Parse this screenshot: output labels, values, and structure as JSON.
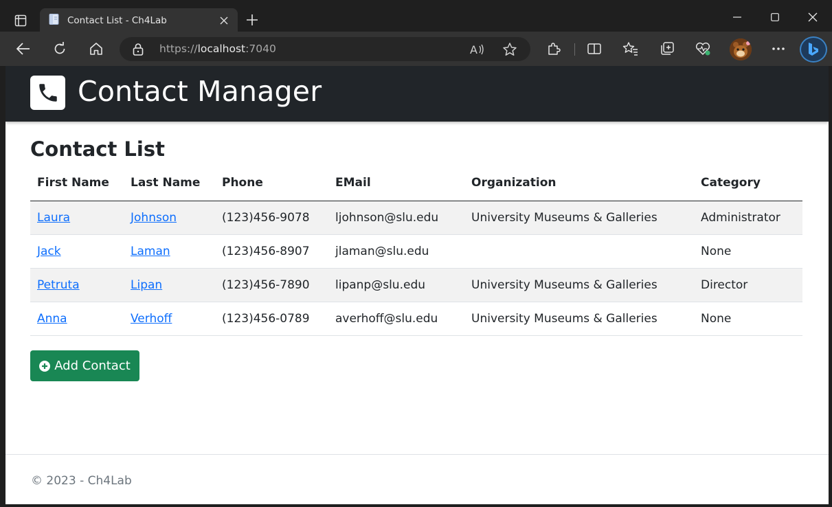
{
  "browser": {
    "tab_title": "Contact List - Ch4Lab",
    "address": {
      "scheme": "https://",
      "host": "localhost",
      "port": ":7040"
    },
    "icons": [
      "tab-actions-icon",
      "page-icon",
      "close-icon",
      "plus-icon",
      "minimize-icon",
      "maximize-icon",
      "window-close-icon",
      "back-icon",
      "refresh-icon",
      "home-icon",
      "lock-icon",
      "read-aloud-icon",
      "favorite-star-icon",
      "extensions-icon",
      "split-screen-icon",
      "favorites-icon",
      "collections-icon",
      "browser-essentials-icon",
      "profile-avatar-icon",
      "more-icon",
      "bing-copilot-icon"
    ]
  },
  "site": {
    "brand": "Contact Manager",
    "logo_icon": "phone-icon"
  },
  "main": {
    "title": "Contact List",
    "columns": [
      "First Name",
      "Last Name",
      "Phone",
      "EMail",
      "Organization",
      "Category"
    ],
    "rows": [
      {
        "first": "Laura",
        "last": "Johnson",
        "phone": "(123)456-9078",
        "email": "ljohnson@slu.edu",
        "organization": "University Museums & Galleries",
        "category": "Administrator"
      },
      {
        "first": "Jack",
        "last": "Laman",
        "phone": "(123)456-8907",
        "email": "jlaman@slu.edu",
        "organization": "",
        "category": "None"
      },
      {
        "first": "Petruta",
        "last": "Lipan",
        "phone": "(123)456-7890",
        "email": "lipanp@slu.edu",
        "organization": "University Museums & Galleries",
        "category": "Director"
      },
      {
        "first": "Anna",
        "last": "Verhoff",
        "phone": "(123)456-0789",
        "email": "averhoff@slu.edu",
        "organization": "University Museums & Galleries",
        "category": "None"
      }
    ],
    "add_button": "Add Contact"
  },
  "footer": {
    "text": "© 2023 - Ch4Lab"
  },
  "colors": {
    "header_bg": "#212529",
    "link": "#0d6efd",
    "success": "#198754",
    "stripe": "#f2f2f2"
  }
}
